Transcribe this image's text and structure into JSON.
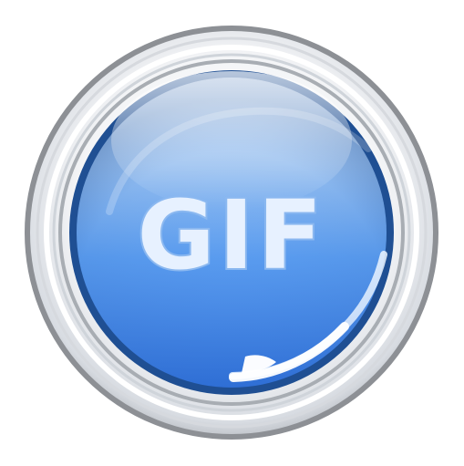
{
  "icon": {
    "label": "GIF",
    "semantic": "gif-app-icon",
    "colors": {
      "background": "#ffffff",
      "ring_light": "#f4f5f7",
      "ring_dark": "#8d9095",
      "disc_rim": "#1f4f93",
      "disc_top": "#9fc7f6",
      "disc_mid": "#4f93e7",
      "disc_bottom": "#2f6fd6",
      "label_fill": "#e7f1ff",
      "label_stroke": "#8bb8f0"
    }
  }
}
